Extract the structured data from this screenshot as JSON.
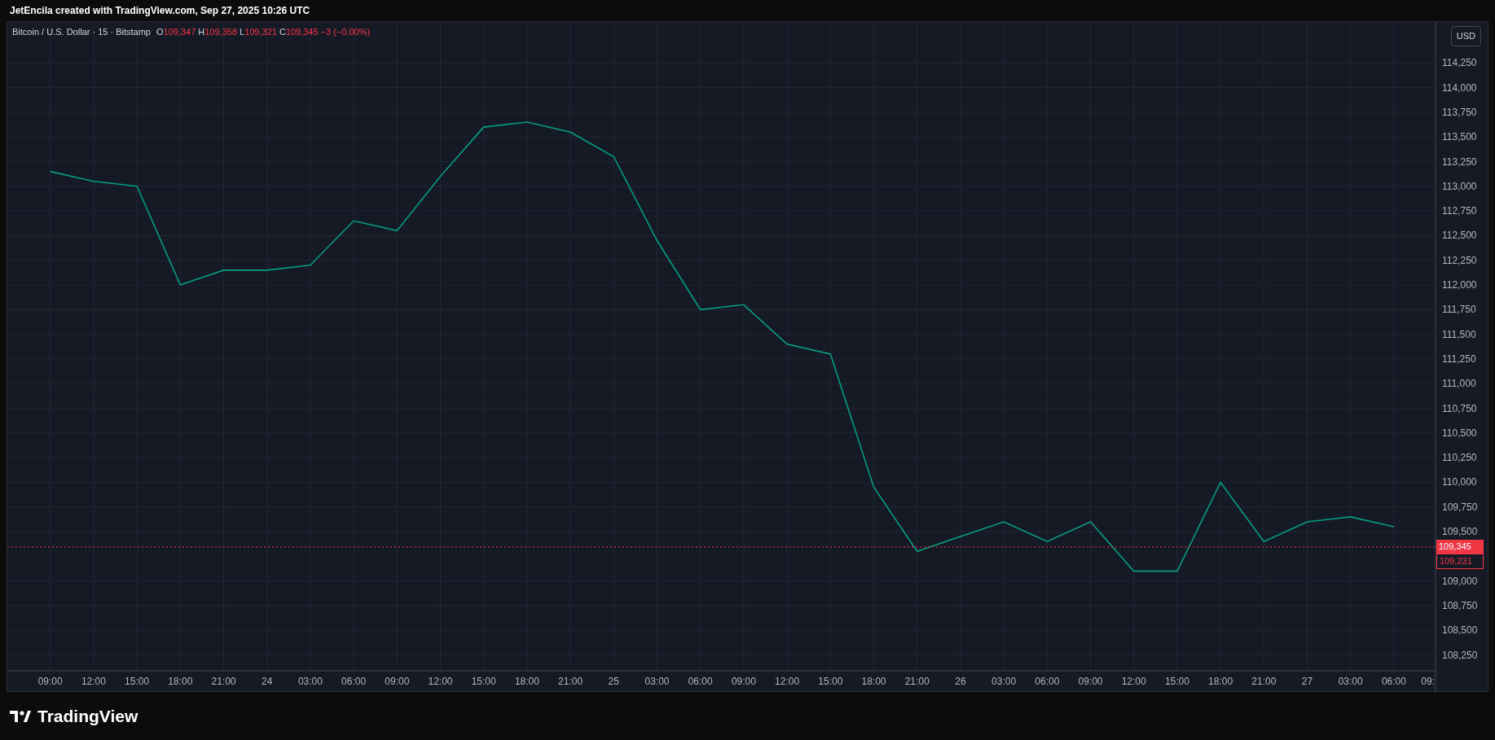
{
  "attribution": "JetEncila created with TradingView.com, Sep 27, 2025 10:26 UTC",
  "legend": {
    "symbol": "Bitcoin / U.S. Dollar · 15 · Bitstamp",
    "ohlc": [
      {
        "label": "O",
        "value": "109,347"
      },
      {
        "label": "H",
        "value": "109,358"
      },
      {
        "label": "L",
        "value": "109,321"
      },
      {
        "label": "C",
        "value": "109,345"
      }
    ],
    "change": "−3 (−0.00%)"
  },
  "currency": "USD",
  "price_tags": [
    {
      "text": "109,345",
      "kind": "filled"
    },
    {
      "text": "109,231",
      "kind": "outline"
    }
  ],
  "chart_data": {
    "type": "line",
    "categories": [
      "09:00",
      "12:00",
      "15:00",
      "18:00",
      "21:00",
      "24",
      "03:00",
      "06:00",
      "09:00",
      "12:00",
      "15:00",
      "18:00",
      "21:00",
      "25",
      "03:00",
      "06:00",
      "09:00",
      "12:00",
      "15:00",
      "18:00",
      "21:00",
      "26",
      "03:00",
      "06:00",
      "09:00",
      "12:00",
      "15:00",
      "18:00",
      "21:00",
      "27",
      "03:00",
      "06:00"
    ],
    "series": [
      {
        "color": "#089981",
        "values": [
          113150,
          113050,
          113000,
          112000,
          112150,
          112150,
          112200,
          112650,
          112550,
          113100,
          113600,
          113650,
          113550,
          113300,
          112450,
          111750,
          111800,
          111400,
          111300,
          109950,
          109300,
          109450,
          109600,
          109400,
          109600,
          109100,
          109100,
          110000,
          109400,
          109600,
          109650,
          109550
        ]
      }
    ],
    "ref_lines": [
      {
        "axis": "y",
        "value": 109345,
        "color": "#f23645"
      }
    ],
    "grid": true,
    "ylim": [
      108090,
      114665
    ],
    "yticks": [
      {
        "value": 108250,
        "label": "108,250"
      },
      {
        "value": 108500,
        "label": "108,500"
      },
      {
        "value": 108750,
        "label": "108,750"
      },
      {
        "value": 109000,
        "label": "109,000"
      },
      {
        "value": 109500,
        "label": "109,500"
      },
      {
        "value": 109750,
        "label": "109,750"
      },
      {
        "value": 110000,
        "label": "110,000"
      },
      {
        "value": 110250,
        "label": "110,250"
      },
      {
        "value": 110500,
        "label": "110,500"
      },
      {
        "value": 110750,
        "label": "110,750"
      },
      {
        "value": 111000,
        "label": "111,000"
      },
      {
        "value": 111250,
        "label": "111,250"
      },
      {
        "value": 111500,
        "label": "111,500"
      },
      {
        "value": 111750,
        "label": "111,750"
      },
      {
        "value": 112000,
        "label": "112,000"
      },
      {
        "value": 112250,
        "label": "112,250"
      },
      {
        "value": 112500,
        "label": "112,500"
      },
      {
        "value": 112750,
        "label": "112,750"
      },
      {
        "value": 113000,
        "label": "113,000"
      },
      {
        "value": 113250,
        "label": "113,250"
      },
      {
        "value": 113500,
        "label": "113,500"
      },
      {
        "value": 113750,
        "label": "113,750"
      },
      {
        "value": 114000,
        "label": "114,000"
      },
      {
        "value": 114250,
        "label": "114,250"
      }
    ]
  },
  "time_axis_edge_label": "09:",
  "footer": {
    "brand": "TradingView"
  }
}
